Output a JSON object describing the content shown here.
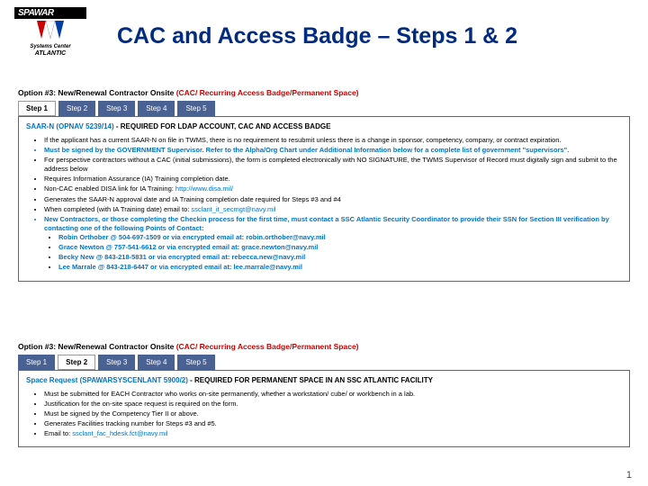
{
  "logo": {
    "brand": "SPAWAR",
    "line1": "Systems Center",
    "line2": "ATLANTIC"
  },
  "title": "CAC and Access Badge – Steps 1 & 2",
  "option_label": "Option #3: New/Renewal Contractor Onsite ",
  "option_red": "(CAC/ Recurring Access Badge/Permanent Space)",
  "tabs": [
    "Step 1",
    "Step 2",
    "Step 3",
    "Step 4",
    "Step 5"
  ],
  "sec1": {
    "title_blue": "SAAR-N (OPNAV 5239/14)",
    "title_black": " - REQUIRED FOR LDAP ACCOUNT, CAC AND ACCESS BADGE",
    "b1": "If the applicant has a current SAAR-N on file in TWMS, there is no requirement to resubmit unless there is a change in sponsor, competency, company, or contract expiration.",
    "b2": "Must be signed by the GOVERNMENT Supervisor. Refer to the Alpha/Org Chart under Additional Information below for a complete list of government \"supervisors\".",
    "b3": "For perspective contractors without a CAC (initial submissions), the form is completed electronically with NO SIGNATURE, the TWMS Supervisor of Record must digitally sign and submit to the address below",
    "b4": "Requires Information Assurance (IA) Training completion date.",
    "b5a": "Non-CAC enabled DISA link for IA Training: ",
    "b5b": "http://www.disa.mil/",
    "b6": "Generates the SAAR-N approval date and IA Training completion date required for Steps #3 and #4",
    "b7a": "When completed (with IA Training date) email to: ",
    "b7b": "ssclant_it_secmgt@navy.mil",
    "b8": "New Contractors, or those completing the Checkin process for the first time, must contact a SSC Atlantic Security Coordinator to provide their SSN for Section III verification by contacting one of the following Points of Contact:",
    "c1n": "Robin Orthober",
    "c1p": "@ 504-697-1509 or via encrypted email at: ",
    "c1e": "robin.orthober@navy.mil",
    "c2n": "Grace Newton",
    "c2p": "@ 757-541-6612 or via encrypted email at: ",
    "c2e": "grace.newton@navy.mil",
    "c3n": "Becky New",
    "c3p": "@ 843-218-5831 or via encrypted email at: ",
    "c3e": "rebecca.new@navy.mil",
    "c4n": "Lee Marrale",
    "c4p": "@ 843-218-6447 or via encrypted email at: ",
    "c4e": "lee.marrale@navy.mil"
  },
  "sec2": {
    "title_blue": "Space Request (SPAWARSYSCENLANT 5900/2)",
    "title_black": " - REQUIRED FOR PERMANENT SPACE IN AN SSC ATLANTIC FACILITY",
    "b1": "Must be submitted for EACH Contractor who works on-site permanently, whether a workstation/ cube/ or workbench in a lab.",
    "b2": "Justification for the on-site space request is required on the form.",
    "b3": "Must be signed by the Competency Tier II or above.",
    "b4": "Generates Facilities tracking number for Steps #3 and #5.",
    "b5a": "Email to: ",
    "b5b": "ssclant_fac_hdesk.fct@navy.mil"
  },
  "pagenum": "1"
}
